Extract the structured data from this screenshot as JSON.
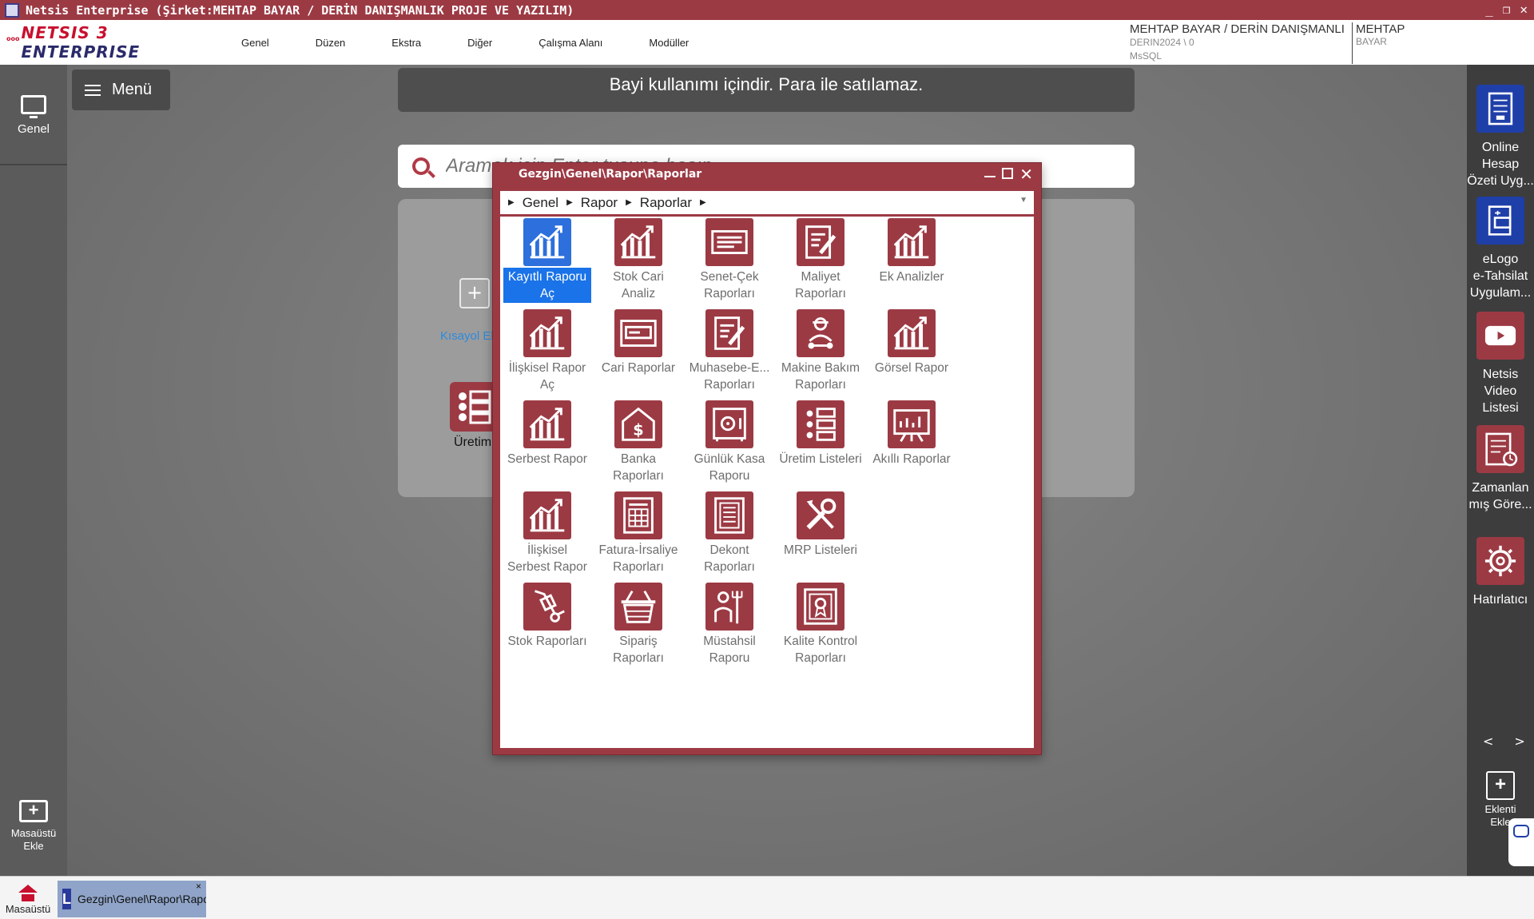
{
  "window": {
    "title": "Netsis Enterprise (Şirket:MEHTAP BAYAR / DERİN DANIŞMANLIK PROJE VE YAZILIM)"
  },
  "logo": {
    "small": "ooo",
    "brand": "NETSIS",
    "version": "3",
    "product": "ENTERPRISE"
  },
  "menubar": {
    "items": [
      "Genel",
      "Düzen",
      "Ekstra",
      "Diğer",
      "Çalışma Alanı",
      "Modüller"
    ]
  },
  "user": {
    "company": "MEHTAP BAYAR / DERİN DANIŞMANLI",
    "db": "DERIN2024 \\ 0",
    "server": "MsSQL",
    "name": "MEHTAP",
    "surname": "BAYAR"
  },
  "left": {
    "genel_label": "Genel",
    "add_desktop_line1": "Masaüstü",
    "add_desktop_line2": "Ekle"
  },
  "menu_button": {
    "label": "Menü"
  },
  "banner": {
    "text": "Bayi kullanımı içindir. Para ile satılamaz."
  },
  "search": {
    "placeholder": "Aramak için Enter tuşuna basın"
  },
  "panel": {
    "kisayol_label": "Kısayol Ekle",
    "uretim_label": "Üretim"
  },
  "right": {
    "tiles": [
      {
        "label1": "Online",
        "label2": "Hesap",
        "label3": "Özeti Uyg...",
        "icon": "document-icon",
        "color": "#1f3fa8"
      },
      {
        "label1": "eLogo",
        "label2": "e-Tahsilat",
        "label3": "Uygulam...",
        "icon": "card-icon",
        "color": "#1f3fa8"
      },
      {
        "label1": "Netsis",
        "label2": "Video",
        "label3": "Listesi",
        "icon": "play-icon",
        "color": "#9c3a44"
      },
      {
        "label1": "Zamanlan",
        "label2": "mış Göre...",
        "label3": "",
        "icon": "scheduled-task-icon",
        "color": "#9c3a44"
      },
      {
        "label1": "Hatırlatıcı",
        "label2": "",
        "label3": "",
        "icon": "gear-icon",
        "color": "#9c3a44"
      }
    ],
    "nav_prev": "<",
    "nav_next": ">",
    "add_line1": "Eklenti",
    "add_line2": "Ekle"
  },
  "taskbar": {
    "home_label": "Masaüstü",
    "task_label": "Gezgin\\Genel\\Rapor\\Raporlar",
    "task_close": "×"
  },
  "dialog": {
    "title": "Gezgin\\Genel\\Rapor\\Raporlar",
    "breadcrumb": [
      "Genel",
      "Rapor",
      "Raporlar"
    ],
    "tiles": [
      {
        "line1": "Kayıtlı Raporu",
        "line2": "Aç",
        "icon": "chart-growth-icon",
        "selected": true
      },
      {
        "line1": "Stok Cari",
        "line2": "Analiz",
        "icon": "chart-growth-icon"
      },
      {
        "line1": "Senet-Çek",
        "line2": "Raporları",
        "icon": "cheque-icon"
      },
      {
        "line1": "Maliyet",
        "line2": "Raporları",
        "icon": "edit-document-icon"
      },
      {
        "line1": "Ek Analizler",
        "line2": "",
        "icon": "chart-growth-icon"
      },
      {
        "line1": "İlişkisel Rapor",
        "line2": "Aç",
        "icon": "chart-growth-icon"
      },
      {
        "line1": "Cari Raporlar",
        "line2": "",
        "icon": "id-card-icon"
      },
      {
        "line1": "Muhasebe-E...",
        "line2": "Raporları",
        "icon": "edit-document-icon"
      },
      {
        "line1": "Makine Bakım",
        "line2": "Raporları",
        "icon": "technician-icon"
      },
      {
        "line1": "Görsel Rapor",
        "line2": "",
        "icon": "chart-growth-icon"
      },
      {
        "line1": "Serbest Rapor",
        "line2": "",
        "icon": "chart-growth-icon"
      },
      {
        "line1": "Banka",
        "line2": "Raporları",
        "icon": "bank-dollar-icon"
      },
      {
        "line1": "Günlük Kasa",
        "line2": "Raporu",
        "icon": "safe-icon"
      },
      {
        "line1": "Üretim Listeleri",
        "line2": "",
        "icon": "checklist-icon"
      },
      {
        "line1": "Akıllı Raporlar",
        "line2": "",
        "icon": "presentation-board-icon"
      },
      {
        "line1": "İlişkisel",
        "line2": "Serbest Rapor",
        "icon": "chart-growth-icon"
      },
      {
        "line1": "Fatura-İrsaliye",
        "line2": "Raporları",
        "icon": "invoice-icon"
      },
      {
        "line1": "Dekont",
        "line2": "Raporları",
        "icon": "receipt-list-icon"
      },
      {
        "line1": "MRP Listeleri",
        "line2": "",
        "icon": "tools-icon"
      },
      {
        "line1": "Stok Raporları",
        "line2": "",
        "icon": "hand-truck-icon"
      },
      {
        "line1": "Sipariş",
        "line2": "Raporları",
        "icon": "basket-icon"
      },
      {
        "line1": "Müstahsil",
        "line2": "Raporu",
        "icon": "farmer-icon"
      },
      {
        "line1": "Kalite Kontrol",
        "line2": "Raporları",
        "icon": "quality-certificate-icon"
      }
    ]
  },
  "colors": {
    "accent": "#9c3a44",
    "selection": "#1a73e8",
    "brand_red": "#c8102e",
    "side_blue": "#1f3fa8"
  }
}
